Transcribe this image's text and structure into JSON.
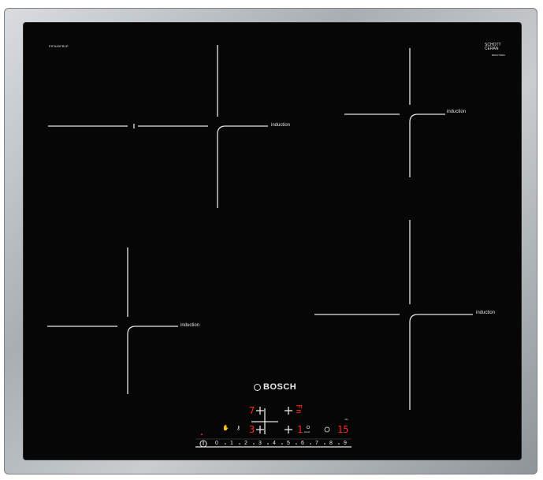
{
  "model_number": "PIF645FB1E",
  "glass_brand": {
    "line1": "SCHOTT",
    "line2": "CERAN",
    "serial": "8001075484"
  },
  "zones": [
    {
      "id": "rear-left",
      "label": "induction"
    },
    {
      "id": "rear-right",
      "label": "induction"
    },
    {
      "id": "front-left",
      "label": "induction"
    },
    {
      "id": "front-right",
      "label": "induction"
    }
  ],
  "brand": "BOSCH",
  "displays": {
    "rear_left_level": "7",
    "front_left_level": "3",
    "front_right_level": "1",
    "rear_right_level": "Fn",
    "timer": "15"
  },
  "controls": {
    "power_icon": "power-icon",
    "childlock_icon": "hand-lock-icon",
    "keepwarm_icon": "key-icon",
    "boost_label": "boost",
    "timer_icon": "clock-icon",
    "timer_label": "min"
  },
  "slider": {
    "levels": [
      "0",
      "1",
      "2",
      "3",
      "4",
      "5",
      "6",
      "7",
      "8",
      "9"
    ]
  },
  "colors": {
    "glass": "#060606",
    "lines": "#e8e8e8",
    "display": "#ff2a1a",
    "frame": "#b4b9bd"
  }
}
